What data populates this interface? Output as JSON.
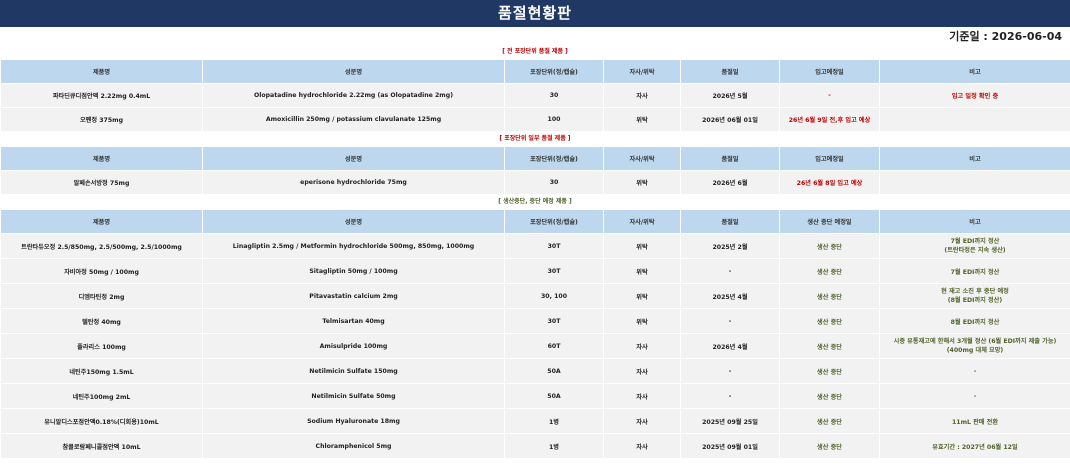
{
  "title": "품절현황판",
  "base_date": "기준일 : 2026-06-04",
  "sections": [
    {
      "heading": "[ 전 포장단위 품절 제품 ]",
      "heading_color": "#c00000",
      "headers": [
        "제품명",
        "성분명",
        "포장단위(정/캡슐)",
        "자사/위탁",
        "품절일",
        "입고예정일",
        "비고"
      ],
      "row_height": 23,
      "rows": [
        [
          "파타딘큐디점안액 2.22mg 0.4mL",
          "Olopatadine hydrochloride 2.22mg (as Olopatadine 2mg)",
          "30",
          "자사",
          "2026년 5월",
          "-",
          "입고 일정 확인 중"
        ],
        [
          "오펜정 375mg",
          "Amoxicillin 250mg /  potassium clavulanate 125mg",
          "100",
          "위탁",
          "2026년 06월 01일",
          "26년 6월 9일 전,후 입고 예상",
          ""
        ]
      ],
      "cell_classes": [
        [
          "",
          "",
          "",
          "",
          "",
          "red",
          "red"
        ],
        [
          "",
          "",
          "",
          "",
          "",
          "red",
          ""
        ]
      ]
    },
    {
      "heading": "[ 포장단위 일부 품절 제품 ]",
      "heading_color": "#c00000",
      "headers": [
        "제품명",
        "성분명",
        "포장단위(정/캡슐)",
        "자사/위탁",
        "품절일",
        "입고예정일",
        "비고"
      ],
      "row_height": 23,
      "rows": [
        [
          "알페손서방정 75mg",
          "eperisone hydrochloride 75mg",
          "30",
          "위탁",
          "2026년 6월",
          "26년 6월 8일 입고 예상",
          ""
        ]
      ],
      "cell_classes": [
        [
          "",
          "",
          "",
          "",
          "",
          "red",
          ""
        ]
      ]
    },
    {
      "heading": "[ 생산중단, 중단 예정 제품 ]",
      "heading_color": "#4f6228",
      "headers": [
        "제품명",
        "성분명",
        "포장단위(정/캡슐)",
        "자사/위탁",
        "품절일",
        "생산 중단 예정일",
        "비고"
      ],
      "row_height": 24,
      "rows": [
        [
          "트란타듀오정 2.5/850mg, 2.5/500mg, 2.5/1000mg",
          "Linagliptin 2.5mg / Metformin hydrochloride 500mg, 850mg, 1000mg",
          "30T",
          "위탁",
          "2025년 2월",
          "생산 중단",
          "7월 EDI까지 정산\n(트란타정은 지속 생산)"
        ],
        [
          "자비아정 50mg / 100mg",
          "Sitagliptin 50mg / 100mg",
          "30T",
          "위탁",
          "-",
          "생산 중단",
          "7월 EDI까지 정산"
        ],
        [
          "디엠타틴정 2mg",
          "Pitavastatin calcium 2mg",
          "30, 100",
          "위탁",
          "2025년 4월",
          "생산 중단",
          "현 재고 소진 후 중단 예정\n(8월 EDI까지 정산)"
        ],
        [
          "텔탄정 40mg",
          "Telmisartan 40mg",
          "30T",
          "위탁",
          "-",
          "생산 중단",
          "8월 EDI까지 정산"
        ],
        [
          "폴라리스 100mg",
          "Amisulpride 100mg",
          "60T",
          "자사",
          "2026년 4월",
          "생산 중단",
          "시중 유통재고에 한해서 3개월 정산 (6월 EDI까지 제출 가능)\n(400mg 대체 요망)"
        ],
        [
          "네틴주150mg 1.5mL",
          "Netilmicin Sulfate 150mg",
          "50A",
          "자사",
          "-",
          "생산 중단",
          "-"
        ],
        [
          "네틴주100mg 2mL",
          "Netilmicin Sulfate 50mg",
          "50A",
          "자사",
          "-",
          "생산 중단",
          "-"
        ],
        [
          "유니알디스포점안액0.18%(디회용)10mL",
          "Sodium Hyaluronate 18mg",
          "1병",
          "자사",
          "2025년 09월 25일",
          "생산 중단",
          "11mL 판매 전환"
        ],
        [
          "참클로람페니콜점안액 10mL",
          "Chloramphenicol 5mg",
          "1병",
          "자사",
          "2025년 09월 01일",
          "생산 중단",
          "유효기간 : 2027년 06월 12일"
        ]
      ],
      "cell_classes": [
        [
          "",
          "",
          "",
          "",
          "",
          "green",
          "green multi"
        ],
        [
          "",
          "",
          "",
          "",
          "",
          "green",
          "green"
        ],
        [
          "",
          "",
          "",
          "",
          "",
          "green",
          "green multi"
        ],
        [
          "",
          "",
          "",
          "",
          "",
          "green",
          "green"
        ],
        [
          "",
          "",
          "",
          "",
          "",
          "green",
          "green multi"
        ],
        [
          "",
          "",
          "",
          "",
          "",
          "green",
          "green"
        ],
        [
          "",
          "",
          "",
          "",
          "",
          "green",
          "green"
        ],
        [
          "",
          "",
          "",
          "",
          "",
          "green",
          "green"
        ],
        [
          "",
          "",
          "",
          "",
          "",
          "green",
          "green"
        ]
      ]
    }
  ]
}
